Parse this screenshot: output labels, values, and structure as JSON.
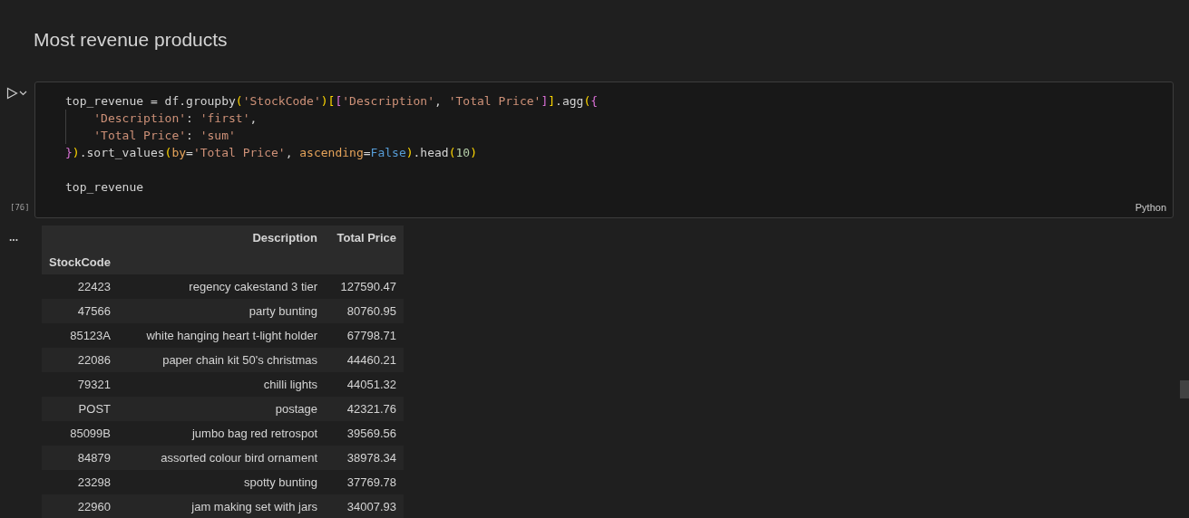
{
  "heading": "Most revenue products",
  "code_cell": {
    "execution_count": "[76]",
    "language": "Python",
    "lines": [
      {
        "tokens": [
          {
            "kind": "text",
            "text": "top_revenue = df.groupby"
          },
          {
            "kind": "bracket1",
            "text": "("
          },
          {
            "kind": "string",
            "text": "'StockCode'"
          },
          {
            "kind": "bracket1",
            "text": ")"
          },
          {
            "kind": "bracket1",
            "text": "["
          },
          {
            "kind": "bracket2",
            "text": "["
          },
          {
            "kind": "string",
            "text": "'Description'"
          },
          {
            "kind": "text",
            "text": ", "
          },
          {
            "kind": "string",
            "text": "'Total Price'"
          },
          {
            "kind": "bracket2",
            "text": "]"
          },
          {
            "kind": "bracket1",
            "text": "]"
          },
          {
            "kind": "text",
            "text": ".agg"
          },
          {
            "kind": "bracket1",
            "text": "("
          },
          {
            "kind": "bracket2",
            "text": "{"
          }
        ]
      },
      {
        "tokens": [
          {
            "kind": "indent"
          },
          {
            "kind": "string",
            "text": "'Description'"
          },
          {
            "kind": "text",
            "text": ": "
          },
          {
            "kind": "string",
            "text": "'first'"
          },
          {
            "kind": "text",
            "text": ","
          }
        ]
      },
      {
        "tokens": [
          {
            "kind": "indent"
          },
          {
            "kind": "string",
            "text": "'Total Price'"
          },
          {
            "kind": "text",
            "text": ": "
          },
          {
            "kind": "string",
            "text": "'sum'"
          }
        ]
      },
      {
        "tokens": [
          {
            "kind": "bracket2",
            "text": "}"
          },
          {
            "kind": "bracket1",
            "text": ")"
          },
          {
            "kind": "text",
            "text": ".sort_values"
          },
          {
            "kind": "bracket1",
            "text": "("
          },
          {
            "kind": "param",
            "text": "by"
          },
          {
            "kind": "text",
            "text": "="
          },
          {
            "kind": "string",
            "text": "'Total Price'"
          },
          {
            "kind": "text",
            "text": ", "
          },
          {
            "kind": "param",
            "text": "ascending"
          },
          {
            "kind": "text",
            "text": "="
          },
          {
            "kind": "keyword",
            "text": "False"
          },
          {
            "kind": "bracket1",
            "text": ")"
          },
          {
            "kind": "text",
            "text": ".head"
          },
          {
            "kind": "bracket1",
            "text": "("
          },
          {
            "kind": "number",
            "text": "10"
          },
          {
            "kind": "bracket1",
            "text": ")"
          }
        ]
      }
    ],
    "result_line": [
      {
        "kind": "text",
        "text": "top_revenue"
      }
    ]
  },
  "output": {
    "more_icon": "...",
    "table": {
      "columns": [
        "",
        "Description",
        "Total Price"
      ],
      "index_name": "StockCode",
      "rows": [
        [
          "22423",
          "regency cakestand 3 tier",
          "127590.47"
        ],
        [
          "47566",
          "party bunting",
          "80760.95"
        ],
        [
          "85123A",
          "white hanging heart t-light holder",
          "67798.71"
        ],
        [
          "22086",
          "paper chain kit 50's christmas",
          "44460.21"
        ],
        [
          "79321",
          "chilli lights",
          "44051.32"
        ],
        [
          "POST",
          "postage",
          "42321.76"
        ],
        [
          "85099B",
          "jumbo bag red retrospot",
          "39569.56"
        ],
        [
          "84879",
          "assorted colour bird ornament",
          "38978.34"
        ],
        [
          "23298",
          "spotty bunting",
          "37769.78"
        ],
        [
          "22960",
          "jam making set with jars",
          "34007.93"
        ]
      ]
    }
  }
}
